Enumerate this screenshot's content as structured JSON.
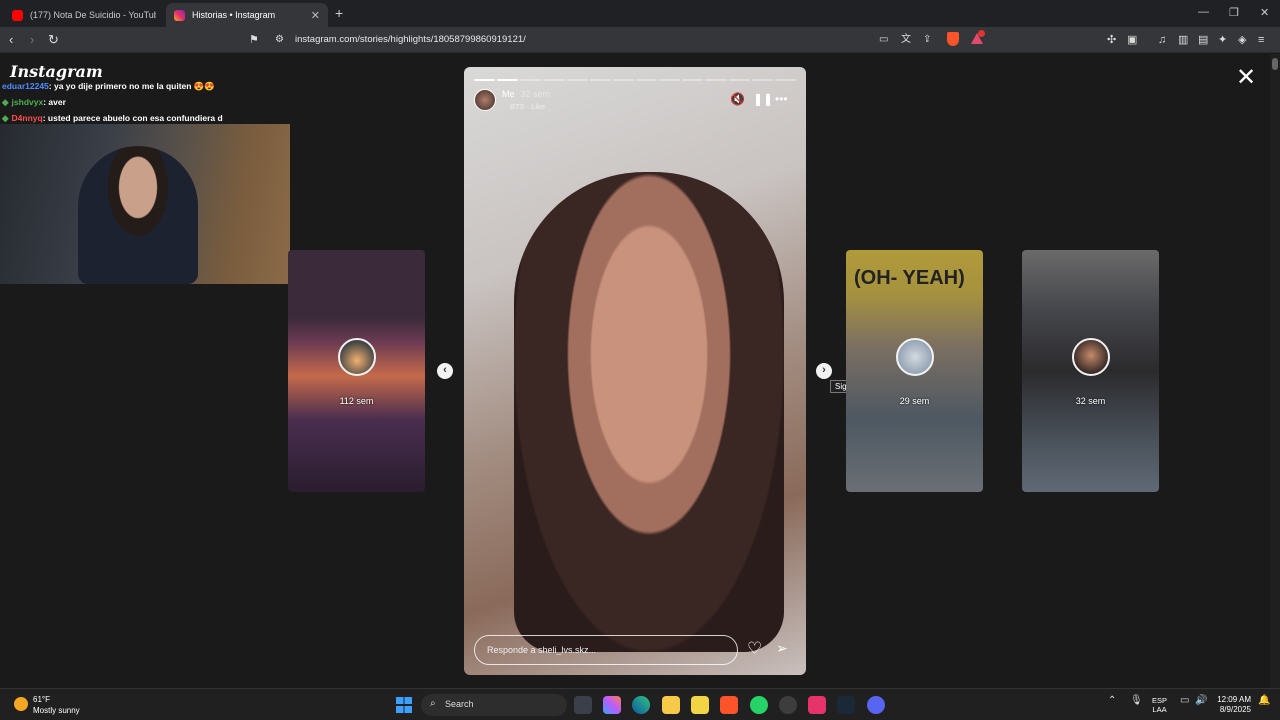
{
  "browser": {
    "tabs": [
      {
        "title": "(177) Nota De Suicidio - YouTube",
        "favicon_color": "#ff0000",
        "active": false
      },
      {
        "title": "Historias • Instagram",
        "favicon_color": "#e1306c",
        "active": true
      }
    ],
    "url": "instagram.com/stories/highlights/18058799860919121/"
  },
  "instagram": {
    "logo": "Instagram"
  },
  "chat": {
    "messages": [
      {
        "user": "eduar12245",
        "text": ": ya yo dije primero no me la quiten 😍😍",
        "user_color": "#4f8cff",
        "badge": ""
      },
      {
        "user": "jshdvyx",
        "text": ": aver",
        "user_color": "#4caf50",
        "badge": "◆"
      },
      {
        "user": "D4nnyq",
        "text": ": usted parece abuelo con esa confundiera d",
        "user_color": "#ff4f4f",
        "badge": "◆"
      }
    ]
  },
  "story": {
    "username": "Me",
    "time": "32 sem",
    "music": "BTS · Like",
    "reply_placeholder": "Responde a sheli_lvs.skz...",
    "segments_total": 14,
    "current_segment": 2
  },
  "side_cards": {
    "left": {
      "time": "112 sem"
    },
    "right1": {
      "time": "29 sem",
      "overlay_text": "(OH- YEAH)"
    },
    "right2": {
      "time": "32 sem"
    }
  },
  "tooltip": "Siguiente",
  "taskbar": {
    "weather_temp": "61°F",
    "weather_desc": "Mostly sunny",
    "search_label": "Search",
    "language": "ESP",
    "language_sub": "LAA",
    "time": "12:09 AM",
    "date": "8/9/2025"
  }
}
